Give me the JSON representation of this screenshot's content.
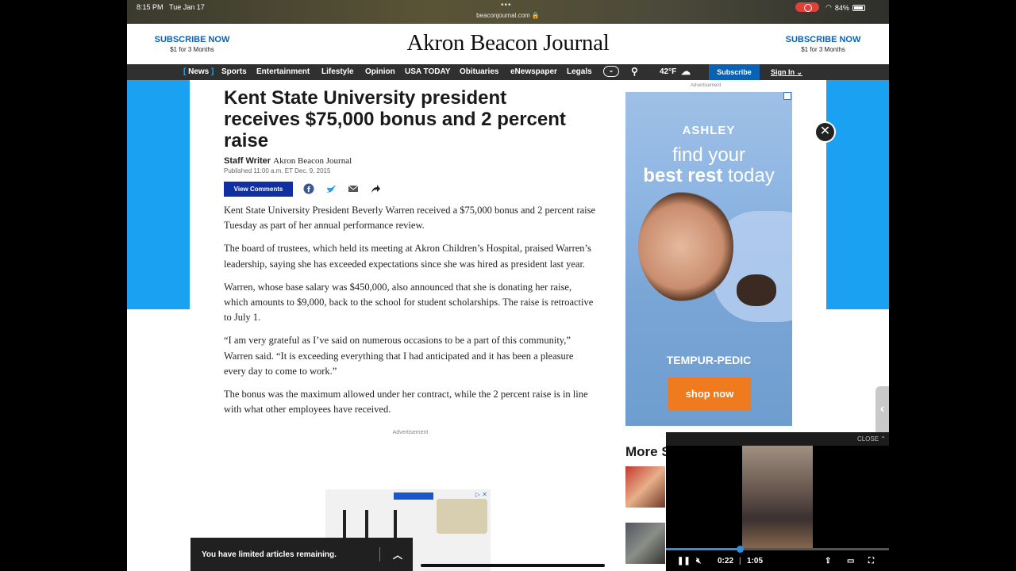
{
  "status_bar": {
    "time": "8:15 PM",
    "date": "Tue Jan 17",
    "url": "beaconjournal.com",
    "battery": "84%"
  },
  "masthead": {
    "logo": "Akron Beacon Journal",
    "subscribe_left": {
      "title": "SUBSCRIBE NOW",
      "offer": "$1 for 3 Months"
    },
    "subscribe_right": {
      "title": "SUBSCRIBE NOW",
      "offer": "$1 for 3 Months"
    }
  },
  "nav": {
    "items": [
      "News",
      "Sports",
      "Entertainment",
      "Lifestyle",
      "Opinion",
      "USA TODAY",
      "Obituaries",
      "eNewspaper",
      "Legals"
    ],
    "weather": "42°F",
    "subscribe": "Subscribe",
    "sign_in": "Sign In"
  },
  "article": {
    "headline": "Kent State University president receives $75,000 bonus and 2 percent raise",
    "author": "Staff Writer",
    "org": "Akron Beacon Journal",
    "published": "Published 11:00 a.m. ET Dec. 9, 2015",
    "view_comments": "View Comments",
    "paragraphs": [
      "Kent State University President Beverly Warren received a $75,000 bonus and 2 percent raise Tuesday as part of her annual performance review.",
      "The board of trustees, which held its meeting at Akron Children’s Hospital, praised Warren’s leadership, saying she has exceeded expectations since she was hired as president last year.",
      "Warren, whose base salary was $450,000, also announced that she is donating her raise, which amounts to $9,000, back to the school for student scholarships. The raise is retroactive to July 1.",
      "“I am very grateful as I’ve said on numerous occasions to be a part of this community,” Warren said. “It is exceeding everything that I had anticipated and it has been a pleasure every day to come to work.”",
      "The bonus was the maximum allowed under her contract, while the 2 percent raise is in line with what other employees have received."
    ],
    "advertisement_label": "Advertisement"
  },
  "sidebar": {
    "ad_label": "Advertisement",
    "ad": {
      "brand": "ASHLEY",
      "line1": "find your",
      "line2_bold": "best rest",
      "line2_rest": " today",
      "partner": "TEMPUR-PEDIC",
      "cta": "shop now"
    },
    "more_heading": "More S"
  },
  "video": {
    "close": "CLOSE",
    "current": "0:22",
    "duration": "1:05",
    "progress": 0.33
  },
  "limited_banner": {
    "text": "You have limited articles remaining."
  }
}
